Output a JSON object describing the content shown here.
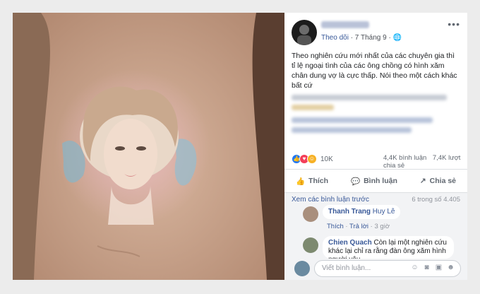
{
  "post": {
    "follow_label": "Theo dõi",
    "date": "· 7 Tháng 9 ·",
    "globe_icon": "globe-icon",
    "more_icon": "more-dots-icon",
    "text": "Theo nghiên cứu mới nhất của các chuyên gia thì tỉ lệ ngoại tình của các ông chồng có hình xăm chân dung vợ là cực thấp. Nói theo một cách khác bất cứ"
  },
  "reactions": {
    "count": "10K",
    "comments": "4,4K bình luận",
    "shares": "7,4K lượt chia sẻ"
  },
  "actions": {
    "like": "Thích",
    "comment": "Bình luận",
    "share": "Chia sẻ"
  },
  "comments_section": {
    "view_previous": "Xem các bình luận trước",
    "count": "6 trong số 4.405",
    "items": [
      {
        "name": "Thanh Trang",
        "tag": "Huy Lê",
        "like": "Thích",
        "reply": "Trả lời",
        "time": "3 giờ"
      },
      {
        "name": "Chien Quach",
        "text": "Còn lại một nghiên cứu khác lại chỉ ra rằng đàn ông xăm hình người yêu"
      }
    ],
    "input_placeholder": "Viết bình luận..."
  },
  "colors": {
    "link": "#385898",
    "like_blue": "#2078f4",
    "love_red": "#f33e58",
    "haha_yellow": "#f7b125"
  }
}
